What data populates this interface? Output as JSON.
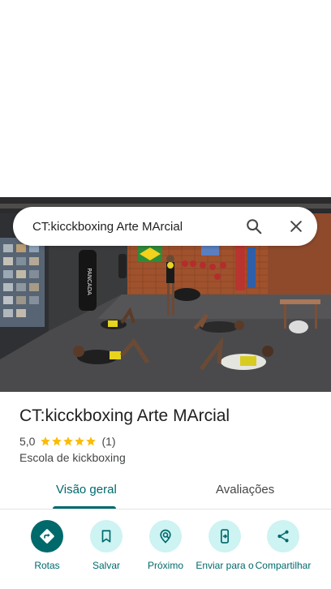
{
  "search": {
    "query": "CT:kicckboxing Arte MArcial"
  },
  "place": {
    "name": "CT:kicckboxing Arte MArcial",
    "rating": "5,0",
    "star_count": 5,
    "review_count": "(1)",
    "category": "Escola de kickboxing"
  },
  "photo": {
    "bag_text": "PANCADA"
  },
  "tabs": [
    {
      "label": "Visão geral",
      "selected": true
    },
    {
      "label": "Avaliações",
      "selected": false
    }
  ],
  "actions": [
    {
      "label": "Rotas",
      "icon": "directions-icon"
    },
    {
      "label": "Salvar",
      "icon": "bookmark-icon"
    },
    {
      "label": "Próximo",
      "icon": "nearby-icon"
    },
    {
      "label": "Enviar para o",
      "icon": "send-to-phone-icon"
    },
    {
      "label": "Compartilhar",
      "icon": "share-icon"
    }
  ],
  "colors": {
    "accent": "#00696b",
    "action_bg": "#cdf3f2",
    "star": "#fbbc04"
  }
}
